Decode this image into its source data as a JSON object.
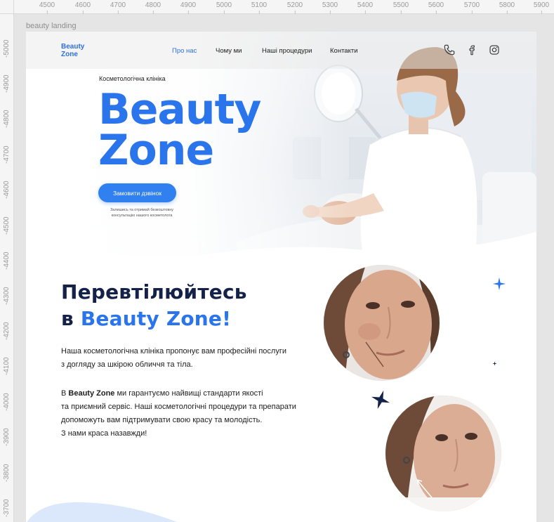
{
  "rulers": {
    "top": [
      "4500",
      "4600",
      "4700",
      "4800",
      "4900",
      "5000",
      "5100",
      "5200",
      "5300",
      "5400",
      "5500",
      "5600",
      "5700",
      "5800",
      "5900"
    ],
    "left": [
      "-5000",
      "-4900",
      "-4800",
      "-4700",
      "-4600",
      "-4500",
      "-4400",
      "-4300",
      "-4200",
      "-4100",
      "-4000",
      "-3900",
      "-3800",
      "-3700"
    ]
  },
  "frame": {
    "label": "beauty landing"
  },
  "logo": {
    "line1": "Beauty",
    "line2": "Zone"
  },
  "nav": {
    "items": [
      {
        "label": "Про нас",
        "active": true
      },
      {
        "label": "Чому ми",
        "active": false
      },
      {
        "label": "Наші процедури",
        "active": false
      },
      {
        "label": "Контакти",
        "active": false
      }
    ],
    "social": [
      "phone-icon",
      "facebook-icon",
      "instagram-icon"
    ]
  },
  "hero": {
    "kicker": "Косметологічна клініка",
    "title_line1": "Beauty",
    "title_line2": "Zone",
    "cta_label": "Замовити дзвінок",
    "cta_note": "Залишись та отримай безкоштовну консультацію нашого косметолога"
  },
  "about": {
    "title_line1": "Перевтілюйтесь",
    "title_prefix": "в ",
    "title_accent": "Beauty Zone!",
    "p1_line1": "Наша косметологічна клініка пропонує вам професійні послуги",
    "p1_line2": "з догляду за шкірою обличчя та тіла.",
    "p2_prefix": "В ",
    "p2_brand": "Beauty Zone",
    "p2_line1_rest": " ми гарантуємо найвищі стандарти якості",
    "p2_line2": "та приємний сервіс. Наші косметологічні процедури та препарати",
    "p2_line3": "допоможуть вам підтримувати свою красу та молодість.",
    "p2_line4": "З нами краса назавжди!"
  },
  "colors": {
    "accent": "#2a74ec",
    "navy": "#14224a",
    "button": "#3080f0"
  }
}
